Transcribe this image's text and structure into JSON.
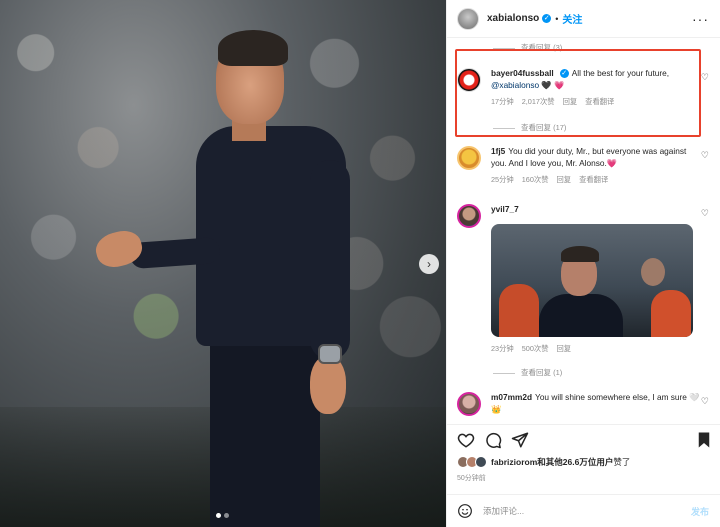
{
  "post": {
    "owner": "xabialonso",
    "follow_label": "关注",
    "more_label": "···"
  },
  "photo": {
    "next_label": "›",
    "slide_count": 2,
    "active_slide": 1
  },
  "comments": {
    "top_replies_label": "查看回复 (3)",
    "items": [
      {
        "username": "bayer04fussball",
        "verified": true,
        "text": "All the best for your future, ",
        "mention": "@xabialonso",
        "emojis": " 🖤 💗",
        "time": "17分钟",
        "likes": "2,017次赞",
        "reply": "回复",
        "translate": "查看翻译",
        "view_replies": "查看回复 (17)"
      },
      {
        "username": "1fj5",
        "text": "You did your duty, Mr., but everyone was against you. And I love you, Mr. Alonso.💗",
        "time": "25分钟",
        "likes": "160次赞",
        "reply": "回复",
        "translate": "查看翻译"
      },
      {
        "username": "yvil7_7",
        "text": "",
        "time": "23分钟",
        "likes": "500次赞",
        "reply": "回复",
        "view_replies": "查看回复 (1)"
      },
      {
        "username": "m07mm2d",
        "text": "You will shine somewhere else, I am sure 🤍 👑"
      }
    ]
  },
  "icons": {
    "heart": "heart-outline",
    "comment": "comment-bubble",
    "share": "paper-plane",
    "save": "bookmark-filled",
    "emoji": "smiley-face"
  },
  "likes": {
    "user": "fabriziorom",
    "and_others": "和其他26.6万位用户",
    "suffix": "赞了"
  },
  "posted_ago": "50分钟前",
  "composer": {
    "placeholder": "添加评论...",
    "post_label": "发布"
  },
  "colors": {
    "accent": "#0095f6",
    "highlight_box": "#e8412c",
    "muted": "#8e8e8e"
  }
}
